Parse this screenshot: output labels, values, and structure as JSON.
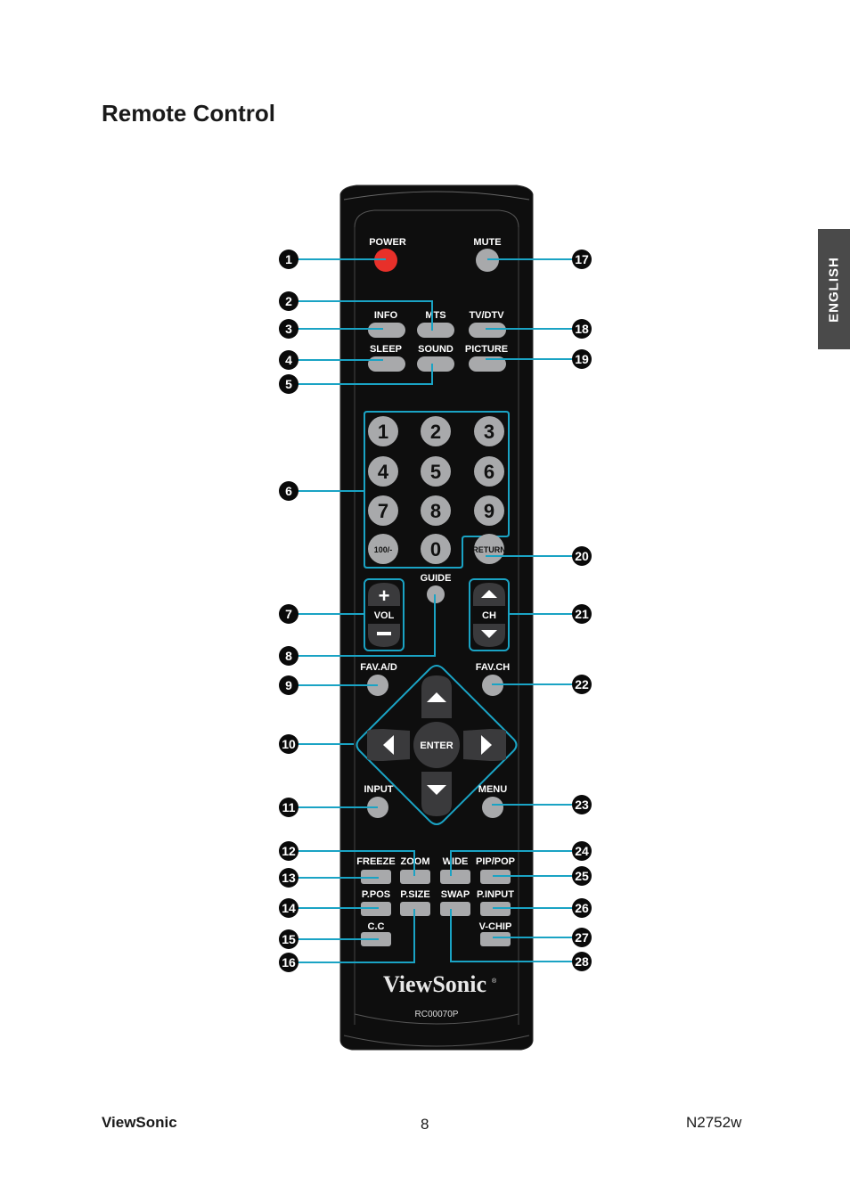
{
  "page": {
    "title": "Remote Control",
    "language_tab": "ENGLISH",
    "footer": {
      "brand": "ViewSonic",
      "page_number": "8",
      "model": "N2752w"
    }
  },
  "remote": {
    "brand": "ViewSonic",
    "brand_mark": "®",
    "model_code": "RC00070P",
    "colors": {
      "body": "#0e0e0e",
      "button": "#a8a9ab",
      "power": "#e8302a",
      "callout_line": "#1aa3c4",
      "dark_button": "#3a3a3c"
    },
    "labels": {
      "power": "POWER",
      "mute": "MUTE",
      "info": "INFO",
      "mts": "MTS",
      "tvdtv": "TV/DTV",
      "sleep": "SLEEP",
      "sound": "SOUND",
      "picture": "PICTURE",
      "guide": "GUIDE",
      "vol": "VOL",
      "ch": "CH",
      "fav_ad": "FAV.A/D",
      "fav_ch": "FAV.CH",
      "enter": "ENTER",
      "input": "INPUT",
      "menu": "MENU",
      "freeze": "FREEZE",
      "zoom": "ZOOM",
      "wide": "WIDE",
      "pippop": "PIP/POP",
      "ppos": "P.POS",
      "psize": "P.SIZE",
      "swap": "SWAP",
      "pinput": "P.INPUT",
      "cc": "C.C",
      "vchip": "V-CHIP"
    },
    "keypad": [
      "1",
      "2",
      "3",
      "4",
      "5",
      "6",
      "7",
      "8",
      "9",
      "100/-",
      "0",
      "RETURN"
    ],
    "vol_plus": "+",
    "vol_minus": "−"
  },
  "callouts": {
    "left": [
      "1",
      "2",
      "3",
      "4",
      "5",
      "6",
      "7",
      "8",
      "9",
      "10",
      "11",
      "12",
      "13",
      "14",
      "15",
      "16"
    ],
    "right": [
      "17",
      "18",
      "19",
      "20",
      "21",
      "22",
      "23",
      "24",
      "25",
      "26",
      "27",
      "28"
    ]
  }
}
